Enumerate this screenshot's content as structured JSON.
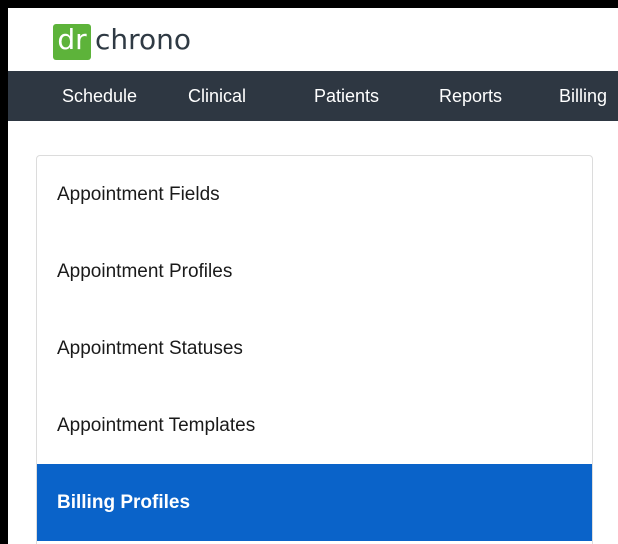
{
  "header": {
    "logo_badge": "dr",
    "logo_text": "chrono"
  },
  "nav": {
    "items": [
      {
        "label": "Schedule"
      },
      {
        "label": "Clinical"
      },
      {
        "label": "Patients"
      },
      {
        "label": "Reports"
      },
      {
        "label": "Billing"
      }
    ]
  },
  "settings_menu": {
    "items": [
      {
        "label": "Appointment Fields"
      },
      {
        "label": "Appointment Profiles"
      },
      {
        "label": "Appointment Statuses"
      },
      {
        "label": "Appointment Templates"
      },
      {
        "label": "Billing Profiles"
      }
    ],
    "active_index": 4
  },
  "colors": {
    "logo_green": "#5db33a",
    "nav_background": "#2e3742",
    "active_item": "#0a63c9"
  }
}
